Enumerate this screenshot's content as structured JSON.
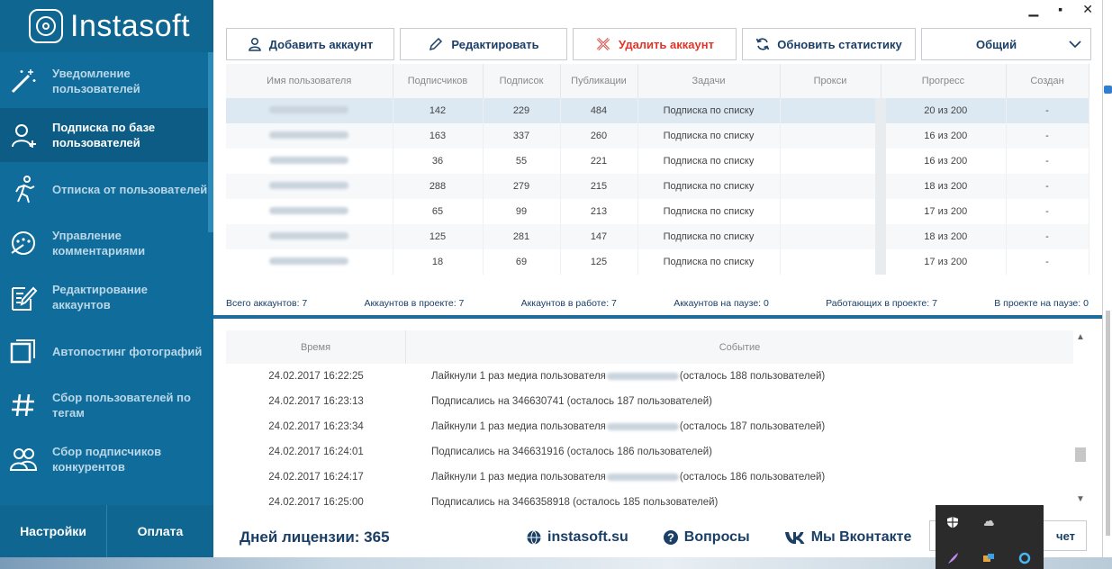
{
  "app": {
    "logo_text": "Instasoft"
  },
  "sidebar": {
    "items": [
      {
        "label": "Уведомление пользователей",
        "icon": "magic-wand-icon",
        "active": false
      },
      {
        "label": "Подписка по базе пользователей",
        "icon": "user-add-icon",
        "active": true
      },
      {
        "label": "Отписка от пользователей",
        "icon": "running-person-icon",
        "active": false
      },
      {
        "label": "Управление комментариями",
        "icon": "comments-icon",
        "active": false
      },
      {
        "label": "Редактирование аккаунтов",
        "icon": "edit-document-icon",
        "active": false
      },
      {
        "label": "Автопостинг фотографий",
        "icon": "photo-stack-icon",
        "active": false
      },
      {
        "label": "Сбор пользователей по тегам",
        "icon": "hashtag-icon",
        "active": false
      },
      {
        "label": "Сбор подписчиков конкурентов",
        "icon": "users-group-icon",
        "active": false
      }
    ],
    "settings_label": "Настройки",
    "payment_label": "Оплата"
  },
  "toolbar": {
    "add_label": "Добавить аккаунт",
    "edit_label": "Редактировать",
    "delete_label": "Удалить аккаунт",
    "refresh_label": "Обновить статистику",
    "filter_value": "Общий"
  },
  "accounts": {
    "columns": [
      "Имя пользователя",
      "Подписчиков",
      "Подписок",
      "Публикации",
      "Задачи",
      "Прокси",
      "Прогресс",
      "Создан"
    ],
    "rows": [
      {
        "followers": "142",
        "following": "229",
        "posts": "484",
        "task": "Подписка по списку",
        "proxy": "",
        "progress": "20 из 200",
        "created": "-"
      },
      {
        "followers": "163",
        "following": "337",
        "posts": "260",
        "task": "Подписка по списку",
        "proxy": "",
        "progress": "16 из 200",
        "created": "-"
      },
      {
        "followers": "36",
        "following": "55",
        "posts": "221",
        "task": "Подписка по списку",
        "proxy": "",
        "progress": "16 из 200",
        "created": "-"
      },
      {
        "followers": "288",
        "following": "279",
        "posts": "215",
        "task": "Подписка по списку",
        "proxy": "",
        "progress": "18 из 200",
        "created": "-"
      },
      {
        "followers": "65",
        "following": "99",
        "posts": "213",
        "task": "Подписка по списку",
        "proxy": "",
        "progress": "17 из 200",
        "created": "-"
      },
      {
        "followers": "125",
        "following": "281",
        "posts": "147",
        "task": "Подписка по списку",
        "proxy": "",
        "progress": "18 из 200",
        "created": "-"
      },
      {
        "followers": "18",
        "following": "69",
        "posts": "125",
        "task": "Подписка по списку",
        "proxy": "",
        "progress": "17 из 200",
        "created": "-"
      }
    ]
  },
  "stats": {
    "total": "Всего аккаунтов: 7",
    "in_project": "Аккаунтов в проекте: 7",
    "in_work": "Аккаунтов в работе: 7",
    "paused": "Аккаунтов на паузе: 0",
    "working_in_project": "Работающих в проекте: 7",
    "paused_in_project": "В проекте на паузе: 0"
  },
  "log": {
    "col_time": "Время",
    "col_event": "Событие",
    "rows": [
      {
        "time": "24.02.2017 16:22:25",
        "pre": "Лайкнули 1 раз медиа пользователя",
        "post": "(осталось 188 пользователей)",
        "masked": true
      },
      {
        "time": "24.02.2017 16:23:13",
        "pre": "Подписались на 346630741 (осталось 187 пользователей)",
        "post": "",
        "masked": false
      },
      {
        "time": "24.02.2017 16:23:34",
        "pre": "Лайкнули 1 раз медиа пользователя",
        "post": "(осталось 187 пользователей)",
        "masked": true
      },
      {
        "time": "24.02.2017 16:24:01",
        "pre": "Подписались на 346631916 (осталось 186 пользователей)",
        "post": "",
        "masked": false
      },
      {
        "time": "24.02.2017 16:24:17",
        "pre": "Лайкнули 1 раз медиа пользователя",
        "post": "(осталось 186 пользователей)",
        "masked": true
      },
      {
        "time": "24.02.2017 16:25:00",
        "pre": "Подписались на 3466358918 (осталось 185 пользователей)",
        "post": "",
        "masked": false
      }
    ]
  },
  "footer": {
    "license": "Дней лицензии: 365",
    "site": "instasoft.su",
    "faq": "Вопросы",
    "vk": "Мы Вконтакте",
    "report_partial": "чет"
  }
}
